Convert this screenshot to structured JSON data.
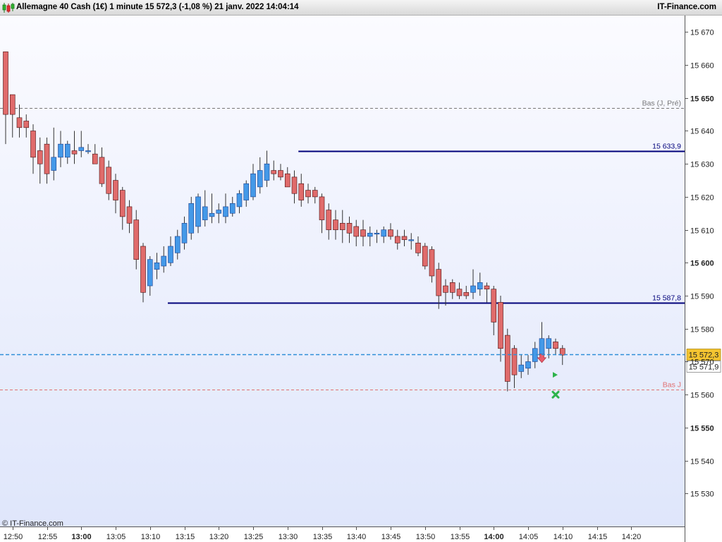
{
  "header": {
    "title": "Allemagne 40 Cash (1€) 1 minute 15 572,3 (-1,08 %) 21 janv. 2022 14:04:14",
    "brand": "IT-Finance.com"
  },
  "chart_data": {
    "type": "candlestick",
    "instrument": "Allemagne 40 Cash (1€)",
    "interval": "1 minute",
    "date": "21 janv. 2022",
    "ylim": [
      15520,
      15675
    ],
    "y_ticks": [
      {
        "value": 15530,
        "label": "15 530",
        "bold": false
      },
      {
        "value": 15540,
        "label": "15 540",
        "bold": false
      },
      {
        "value": 15550,
        "label": "15 550",
        "bold": true
      },
      {
        "value": 15560,
        "label": "15 560",
        "bold": false
      },
      {
        "value": 15570,
        "label": "15 570",
        "bold": false
      },
      {
        "value": 15580,
        "label": "15 580",
        "bold": false
      },
      {
        "value": 15590,
        "label": "15 590",
        "bold": false
      },
      {
        "value": 15600,
        "label": "15 600",
        "bold": true
      },
      {
        "value": 15610,
        "label": "15 610",
        "bold": false
      },
      {
        "value": 15620,
        "label": "15 620",
        "bold": false
      },
      {
        "value": 15630,
        "label": "15 630",
        "bold": false
      },
      {
        "value": 15640,
        "label": "15 640",
        "bold": false
      },
      {
        "value": 15650,
        "label": "15 650",
        "bold": true
      },
      {
        "value": 15660,
        "label": "15 660",
        "bold": false
      },
      {
        "value": 15670,
        "label": "15 670",
        "bold": false
      }
    ],
    "x_ticks": [
      {
        "time": "12:50",
        "bold": false
      },
      {
        "time": "12:55",
        "bold": false
      },
      {
        "time": "13:00",
        "bold": true
      },
      {
        "time": "13:05",
        "bold": false
      },
      {
        "time": "13:10",
        "bold": false
      },
      {
        "time": "13:15",
        "bold": false
      },
      {
        "time": "13:20",
        "bold": false
      },
      {
        "time": "13:25",
        "bold": false
      },
      {
        "time": "13:30",
        "bold": false
      },
      {
        "time": "13:35",
        "bold": false
      },
      {
        "time": "13:40",
        "bold": false
      },
      {
        "time": "13:45",
        "bold": false
      },
      {
        "time": "13:50",
        "bold": false
      },
      {
        "time": "13:55",
        "bold": false
      },
      {
        "time": "14:00",
        "bold": true
      },
      {
        "time": "14:05",
        "bold": false
      },
      {
        "time": "14:10",
        "bold": false
      },
      {
        "time": "14:15",
        "bold": false
      },
      {
        "time": "14:20",
        "bold": false
      }
    ],
    "first_bar_time": "12:49",
    "candles": [
      {
        "o": 15664,
        "h": 15664,
        "l": 15636,
        "c": 15645
      },
      {
        "o": 15651,
        "h": 15651,
        "l": 15638,
        "c": 15645
      },
      {
        "o": 15644,
        "h": 15648,
        "l": 15638,
        "c": 15641
      },
      {
        "o": 15643,
        "h": 15645,
        "l": 15638,
        "c": 15641
      },
      {
        "o": 15640,
        "h": 15642,
        "l": 15627,
        "c": 15632
      },
      {
        "o": 15634,
        "h": 15638,
        "l": 15624,
        "c": 15630
      },
      {
        "o": 15636,
        "h": 15638,
        "l": 15624,
        "c": 15627
      },
      {
        "o": 15628,
        "h": 15641,
        "l": 15625,
        "c": 15632
      },
      {
        "o": 15632,
        "h": 15640,
        "l": 15629,
        "c": 15636
      },
      {
        "o": 15632,
        "h": 15637,
        "l": 15630,
        "c": 15636
      },
      {
        "o": 15634,
        "h": 15640,
        "l": 15630,
        "c": 15633
      },
      {
        "o": 15634,
        "h": 15640,
        "l": 15632,
        "c": 15635
      },
      {
        "o": 15634,
        "h": 15636,
        "l": 15633,
        "c": 15634
      },
      {
        "o": 15633,
        "h": 15636,
        "l": 15630,
        "c": 15630
      },
      {
        "o": 15632,
        "h": 15635,
        "l": 15623,
        "c": 15624
      },
      {
        "o": 15629,
        "h": 15631,
        "l": 15619,
        "c": 15621
      },
      {
        "o": 15625,
        "h": 15627,
        "l": 15615,
        "c": 15619
      },
      {
        "o": 15622,
        "h": 15623,
        "l": 15610,
        "c": 15614
      },
      {
        "o": 15617,
        "h": 15619,
        "l": 15609,
        "c": 15612
      },
      {
        "o": 15613,
        "h": 15616,
        "l": 15598,
        "c": 15601
      },
      {
        "o": 15605,
        "h": 15606,
        "l": 15588,
        "c": 15591
      },
      {
        "o": 15593,
        "h": 15602,
        "l": 15590,
        "c": 15601
      },
      {
        "o": 15598,
        "h": 15603,
        "l": 15595,
        "c": 15600
      },
      {
        "o": 15599,
        "h": 15605,
        "l": 15597,
        "c": 15602
      },
      {
        "o": 15600,
        "h": 15608,
        "l": 15599,
        "c": 15605
      },
      {
        "o": 15603,
        "h": 15610,
        "l": 15601,
        "c": 15608
      },
      {
        "o": 15606,
        "h": 15614,
        "l": 15604,
        "c": 15612
      },
      {
        "o": 15609,
        "h": 15620,
        "l": 15607,
        "c": 15618
      },
      {
        "o": 15611,
        "h": 15621,
        "l": 15609,
        "c": 15620
      },
      {
        "o": 15613,
        "h": 15622,
        "l": 15611,
        "c": 15617
      },
      {
        "o": 15614,
        "h": 15621,
        "l": 15612,
        "c": 15615
      },
      {
        "o": 15615,
        "h": 15618,
        "l": 15612,
        "c": 15616
      },
      {
        "o": 15614,
        "h": 15621,
        "l": 15612,
        "c": 15617
      },
      {
        "o": 15615,
        "h": 15620,
        "l": 15614,
        "c": 15618
      },
      {
        "o": 15617,
        "h": 15622,
        "l": 15615,
        "c": 15621
      },
      {
        "o": 15619,
        "h": 15625,
        "l": 15617,
        "c": 15624
      },
      {
        "o": 15620,
        "h": 15630,
        "l": 15619,
        "c": 15627
      },
      {
        "o": 15623,
        "h": 15632,
        "l": 15621,
        "c": 15628
      },
      {
        "o": 15625,
        "h": 15634,
        "l": 15623,
        "c": 15630
      },
      {
        "o": 15628,
        "h": 15631,
        "l": 15625,
        "c": 15627
      },
      {
        "o": 15628,
        "h": 15630,
        "l": 15625,
        "c": 15626
      },
      {
        "o": 15627,
        "h": 15629,
        "l": 15623,
        "c": 15623
      },
      {
        "o": 15626,
        "h": 15628,
        "l": 15618,
        "c": 15621
      },
      {
        "o": 15624,
        "h": 15627,
        "l": 15617,
        "c": 15619
      },
      {
        "o": 15622,
        "h": 15624,
        "l": 15618,
        "c": 15620
      },
      {
        "o": 15622,
        "h": 15623,
        "l": 15618,
        "c": 15620
      },
      {
        "o": 15620,
        "h": 15621,
        "l": 15609,
        "c": 15613
      },
      {
        "o": 15616,
        "h": 15618,
        "l": 15607,
        "c": 15610
      },
      {
        "o": 15613,
        "h": 15616,
        "l": 15607,
        "c": 15610
      },
      {
        "o": 15612,
        "h": 15616,
        "l": 15606,
        "c": 15610
      },
      {
        "o": 15612,
        "h": 15614,
        "l": 15606,
        "c": 15609
      },
      {
        "o": 15611,
        "h": 15613,
        "l": 15605,
        "c": 15608
      },
      {
        "o": 15610,
        "h": 15613,
        "l": 15605,
        "c": 15608
      },
      {
        "o": 15608,
        "h": 15611,
        "l": 15605,
        "c": 15609
      },
      {
        "o": 15609,
        "h": 15610,
        "l": 15606,
        "c": 15609
      },
      {
        "o": 15608,
        "h": 15611,
        "l": 15606,
        "c": 15610
      },
      {
        "o": 15610,
        "h": 15612,
        "l": 15607,
        "c": 15608
      },
      {
        "o": 15608,
        "h": 15610,
        "l": 15604,
        "c": 15606
      },
      {
        "o": 15608,
        "h": 15610,
        "l": 15605,
        "c": 15607
      },
      {
        "o": 15607,
        "h": 15609,
        "l": 15604,
        "c": 15607
      },
      {
        "o": 15606,
        "h": 15608,
        "l": 15602,
        "c": 15603
      },
      {
        "o": 15605,
        "h": 15606,
        "l": 15598,
        "c": 15599
      },
      {
        "o": 15604,
        "h": 15605,
        "l": 15594,
        "c": 15596
      },
      {
        "o": 15598,
        "h": 15600,
        "l": 15586,
        "c": 15590
      },
      {
        "o": 15593,
        "h": 15595,
        "l": 15587,
        "c": 15591
      },
      {
        "o": 15594,
        "h": 15595,
        "l": 15589,
        "c": 15591
      },
      {
        "o": 15592,
        "h": 15594,
        "l": 15589,
        "c": 15590
      },
      {
        "o": 15591,
        "h": 15593,
        "l": 15589,
        "c": 15590
      },
      {
        "o": 15591,
        "h": 15598,
        "l": 15589,
        "c": 15593
      },
      {
        "o": 15592,
        "h": 15597,
        "l": 15590,
        "c": 15594
      },
      {
        "o": 15593,
        "h": 15594,
        "l": 15588,
        "c": 15592
      },
      {
        "o": 15592,
        "h": 15593,
        "l": 15578,
        "c": 15582
      },
      {
        "o": 15588,
        "h": 15590,
        "l": 15570,
        "c": 15574
      },
      {
        "o": 15578,
        "h": 15580,
        "l": 15561,
        "c": 15564
      },
      {
        "o": 15574,
        "h": 15575,
        "l": 15562,
        "c": 15566
      },
      {
        "o": 15567,
        "h": 15572,
        "l": 15565,
        "c": 15569
      },
      {
        "o": 15568,
        "h": 15572,
        "l": 15566,
        "c": 15570
      },
      {
        "o": 15570,
        "h": 15576,
        "l": 15568,
        "c": 15574
      },
      {
        "o": 15572,
        "h": 15582,
        "l": 15570,
        "c": 15577
      },
      {
        "o": 15574,
        "h": 15578,
        "l": 15571,
        "c": 15577
      },
      {
        "o": 15576,
        "h": 15577,
        "l": 15572,
        "c": 15574
      },
      {
        "o": 15574,
        "h": 15575,
        "l": 15569,
        "c": 15572
      }
    ],
    "levels": [
      {
        "name": "prev-day-low",
        "value": 15647,
        "label": "Bas (J, Pré)",
        "color": "#777777",
        "style": "dashed",
        "start_bar": 0
      },
      {
        "name": "resistance",
        "value": 15633.9,
        "label": "15 633,9",
        "color": "#00007a",
        "style": "solid",
        "start_bar": 43
      },
      {
        "name": "support",
        "value": 15587.8,
        "label": "15 587,8",
        "color": "#00007a",
        "style": "solid",
        "start_bar": 24
      },
      {
        "name": "day-low",
        "value": 15561.5,
        "label": "Bas J",
        "color": "#e07070",
        "style": "dashed",
        "start_bar": 0
      }
    ],
    "last_price": {
      "value": 15572.3,
      "label": "15 572,3"
    },
    "second_price": {
      "value": 15571.9,
      "label": "15 571,9"
    },
    "markers": [
      {
        "type": "down-arrow",
        "bar": 78,
        "price": 15571,
        "color": "#e85b6a"
      },
      {
        "type": "right-triangle",
        "bar": 80,
        "price": 15566,
        "color": "#2db34a"
      },
      {
        "type": "cross",
        "bar": 80,
        "price": 15560,
        "color": "#2db34a"
      }
    ],
    "colors": {
      "up": "#4499e8",
      "up_border": "#1d3f8a",
      "down": "#e06b6b",
      "down_border": "#4a1010",
      "wick": "#333333",
      "price_line": "#2f8fd8",
      "price_label_bg": "#f4c430"
    },
    "copyright": "© IT-Finance.com",
    "grid": false
  }
}
